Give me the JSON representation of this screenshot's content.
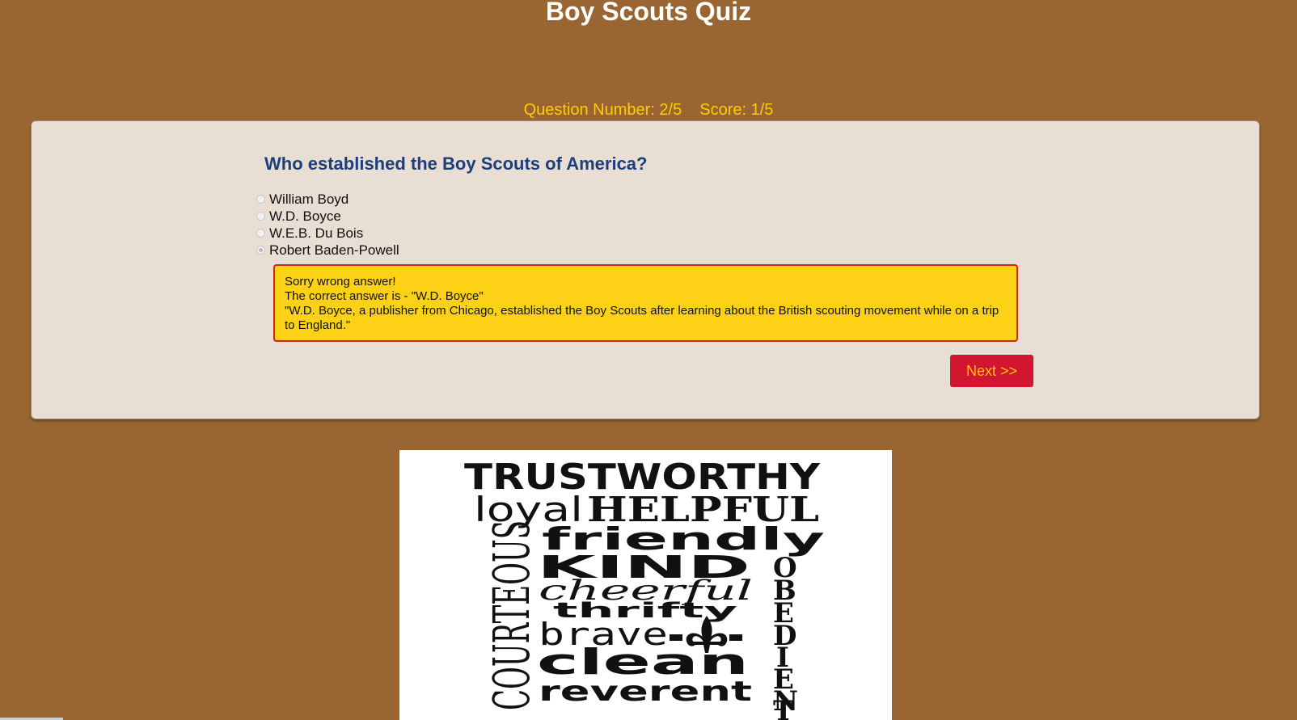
{
  "page": {
    "title": "Boy Scouts Quiz",
    "background_color": "#996633"
  },
  "status": {
    "question_label": "Question Number: 2/5",
    "score_label": "Score: 1/5"
  },
  "quiz": {
    "question": "Who established the Boy Scouts of America?",
    "options": [
      {
        "label": "William Boyd",
        "selected": false
      },
      {
        "label": "W.D. Boyce",
        "selected": false
      },
      {
        "label": "W.E.B. Du Bois",
        "selected": false
      },
      {
        "label": "Robert Baden-Powell",
        "selected": true
      }
    ],
    "feedback": {
      "line1": "Sorry wrong answer!",
      "line2": "The correct answer is - \"W.D. Boyce\"",
      "line3": "\"W.D. Boyce, a publisher from Chicago, established the Boy Scouts after learning about the British scouting movement while on a trip to England.\""
    },
    "next_label": "Next >>"
  },
  "virtues_image": {
    "words": {
      "trustworthy": "TRUSTWORTHY",
      "loyal": "loyal",
      "helpful": "HELPFUL",
      "friendly": "friendly",
      "kind": "KIND",
      "cheerful": "cheerful",
      "thrifty": "thrifty",
      "brave": "brave",
      "clean": "clean",
      "reverent": "reverent",
      "courteous": "COURTEOUS",
      "obedient": "OBEDIENT"
    },
    "emblem_icon": "fleur-de-lis-icon"
  },
  "colors": {
    "title": "#ffffff",
    "status_text": "#ffcc00",
    "card_background": "#e8ded4",
    "question_text": "#1b3f7a",
    "feedback_background": "#fcd116",
    "feedback_border": "#d21f26",
    "button_background": "#d21530",
    "button_text": "#ffcc00"
  }
}
